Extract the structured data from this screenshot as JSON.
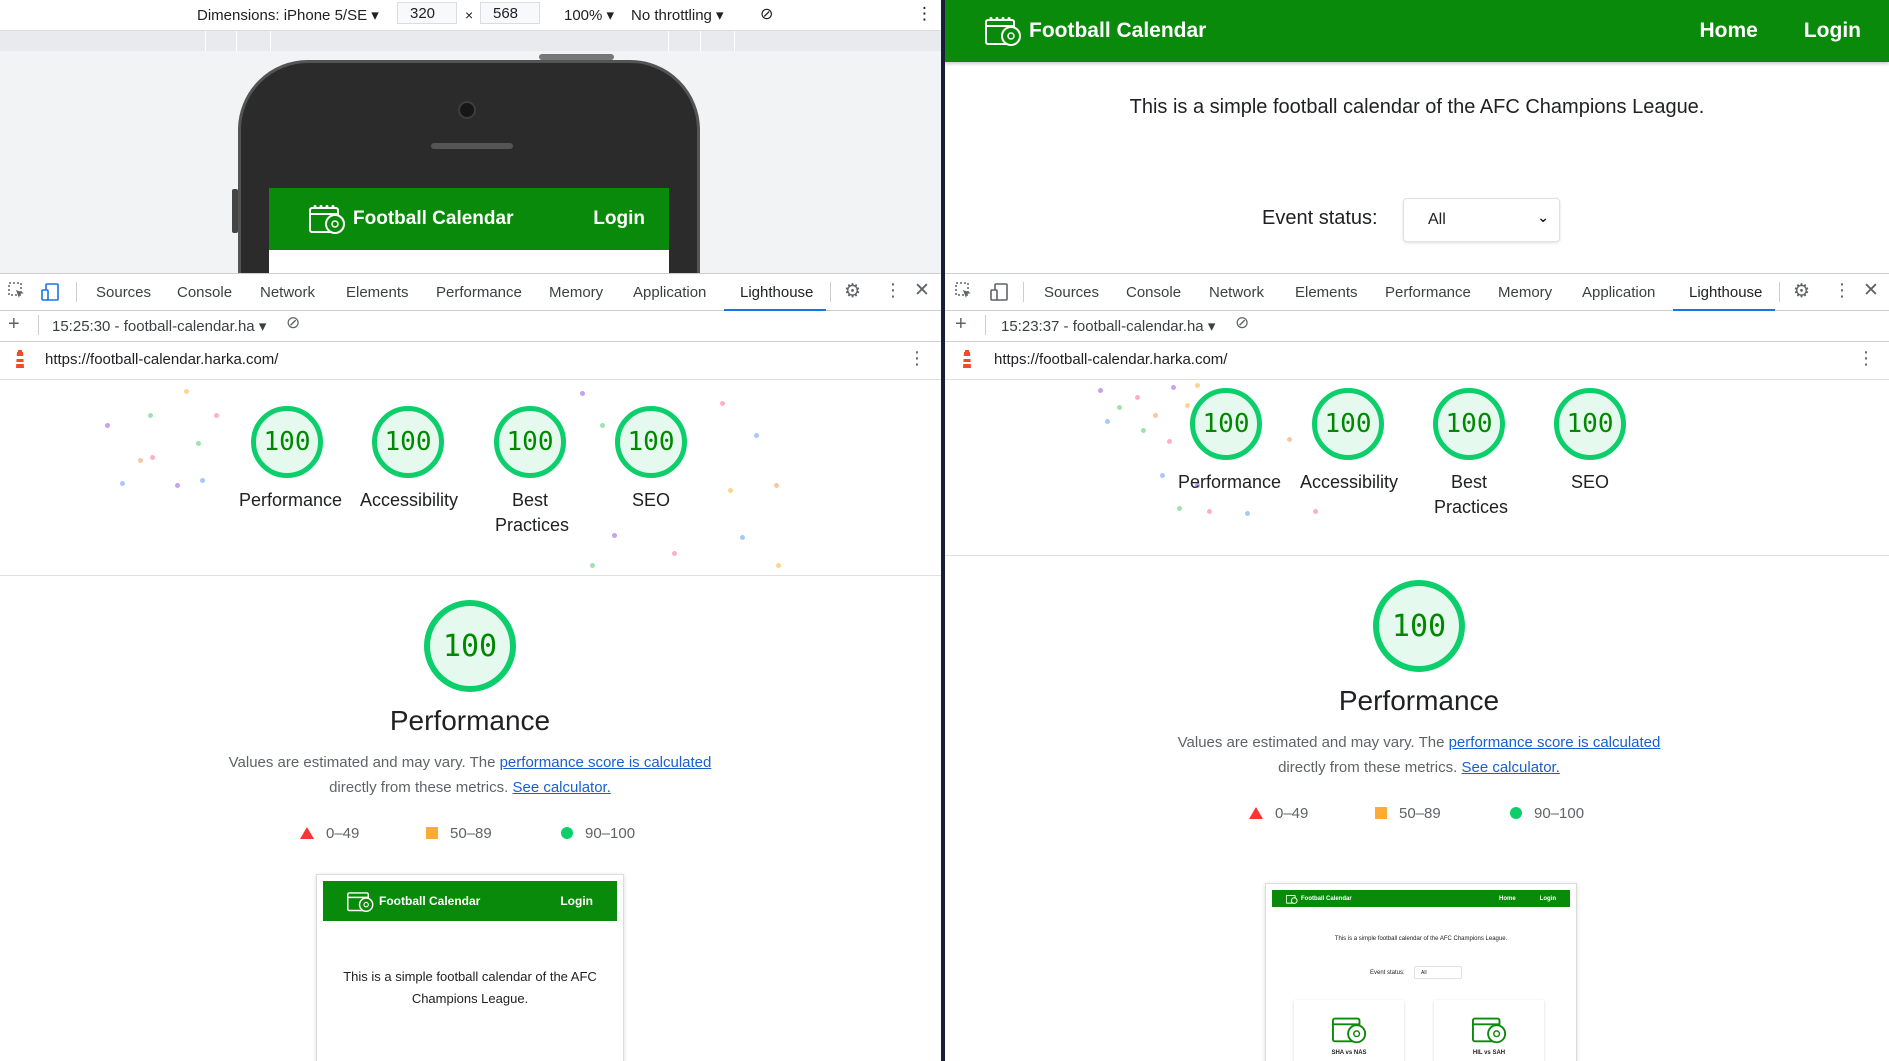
{
  "left": {
    "device_toolbar": {
      "dimensions_label": "Dimensions: iPhone 5/SE",
      "width": "320",
      "times": "×",
      "height": "568",
      "zoom": "100%",
      "throttling": "No throttling"
    },
    "phone_screen": {
      "brand": "Football Calendar",
      "login": "Login"
    },
    "devtools": {
      "tabs": [
        "Sources",
        "Console",
        "Network",
        "Elements",
        "Performance",
        "Memory",
        "Application",
        "Lighthouse"
      ],
      "report_selector": "15:25:30 - football-calendar.ha",
      "url": "https://football-calendar.harka.com/"
    },
    "lighthouse": {
      "gauges": [
        {
          "score": "100",
          "label": "Performance"
        },
        {
          "score": "100",
          "label": "Accessibility"
        },
        {
          "score": "100",
          "label": "Best Practices"
        },
        {
          "score": "100",
          "label": "SEO"
        }
      ],
      "perf_score": "100",
      "perf_title": "Performance",
      "desc_prefix": "Values are estimated and may vary. The ",
      "desc_link1": "performance score is calculated",
      "desc_mid": "directly from these metrics. ",
      "desc_link2": "See calculator.",
      "legend": [
        "0–49",
        "50–89",
        "90–100"
      ],
      "thumbnail": {
        "brand": "Football Calendar",
        "login": "Login",
        "text": "This is a simple football calendar of the AFC Champions League."
      }
    }
  },
  "right": {
    "site": {
      "brand": "Football Calendar",
      "nav": [
        "Home",
        "Login"
      ],
      "intro": "This is a simple football calendar of the AFC Champions League.",
      "event_status_label": "Event status:",
      "event_status_value": "All"
    },
    "devtools": {
      "tabs": [
        "Sources",
        "Console",
        "Network",
        "Elements",
        "Performance",
        "Memory",
        "Application",
        "Lighthouse"
      ],
      "report_selector": "15:23:37 - football-calendar.ha",
      "url": "https://football-calendar.harka.com/"
    },
    "lighthouse": {
      "gauges": [
        {
          "score": "100",
          "label": "Performance"
        },
        {
          "score": "100",
          "label": "Accessibility"
        },
        {
          "score": "100",
          "label": "Best Practices"
        },
        {
          "score": "100",
          "label": "SEO"
        }
      ],
      "perf_score": "100",
      "perf_title": "Performance",
      "desc_prefix": "Values are estimated and may vary. The ",
      "desc_link1": "performance score is calculated",
      "desc_mid": "directly from these metrics. ",
      "desc_link2": "See calculator.",
      "legend": [
        "0–49",
        "50–89",
        "90–100"
      ],
      "thumbnail": {
        "brand": "Football Calendar",
        "nav": [
          "Home",
          "Login"
        ],
        "text": "This is a simple football calendar of the AFC Champions League.",
        "status_label": "Event status:",
        "status_value": "All",
        "cards": [
          "SHA vs NAS",
          "HIL vs SAH"
        ]
      }
    }
  },
  "colors": {
    "brand_green": "#0a8a0a",
    "score_green": "#0cce6b",
    "fail_red": "#ff3333",
    "average_orange": "#ffaa33",
    "active_tab_blue": "#1a73e8"
  }
}
